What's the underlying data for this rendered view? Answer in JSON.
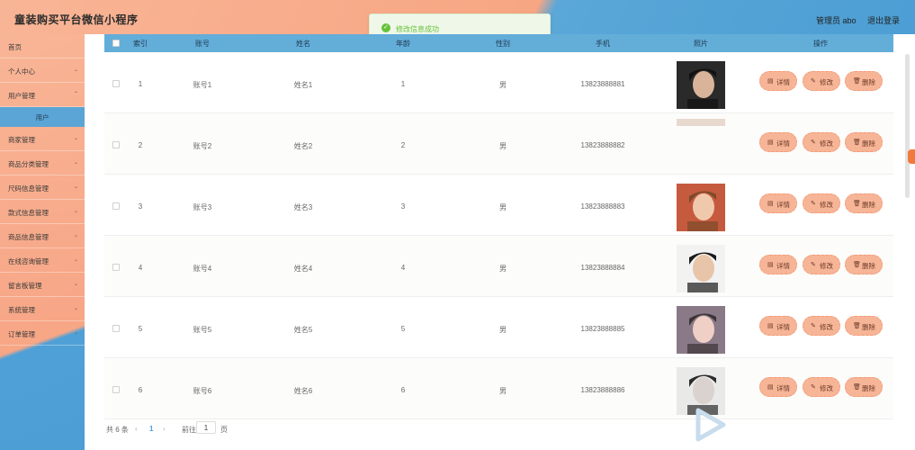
{
  "header": {
    "title": "童装购买平台微信小程序",
    "admin_label": "管理员 abo",
    "logout_label": "退出登录"
  },
  "toast": {
    "message": "修改信息成功",
    "icon": "check-circle-icon"
  },
  "sidebar": {
    "items": [
      {
        "label": "首页",
        "chevron": false
      },
      {
        "label": "个人中心",
        "chevron": true
      },
      {
        "label": "用户管理",
        "chevron": true
      },
      {
        "label": "商家管理",
        "chevron": true
      },
      {
        "label": "商品分类管理",
        "chevron": true
      },
      {
        "label": "尺码信息管理",
        "chevron": true
      },
      {
        "label": "款式信息管理",
        "chevron": true
      },
      {
        "label": "商品信息管理",
        "chevron": true
      },
      {
        "label": "在线咨询管理",
        "chevron": true
      },
      {
        "label": "留言板管理",
        "chevron": true
      },
      {
        "label": "系统管理",
        "chevron": true
      },
      {
        "label": "订单管理",
        "chevron": true
      }
    ],
    "active_sub": "用户"
  },
  "table": {
    "headers": [
      "索引",
      "账号",
      "姓名",
      "年龄",
      "性别",
      "手机",
      "照片",
      "操作"
    ],
    "rows": [
      {
        "index": "1",
        "account": "账号1",
        "name": "姓名1",
        "age": "1",
        "gender": "男",
        "phone": "13823888881"
      },
      {
        "index": "2",
        "account": "账号2",
        "name": "姓名2",
        "age": "2",
        "gender": "男",
        "phone": "13823888882"
      },
      {
        "index": "3",
        "account": "账号3",
        "name": "姓名3",
        "age": "3",
        "gender": "男",
        "phone": "13823888883"
      },
      {
        "index": "4",
        "account": "账号4",
        "name": "姓名4",
        "age": "4",
        "gender": "男",
        "phone": "13823888884"
      },
      {
        "index": "5",
        "account": "账号5",
        "name": "姓名5",
        "age": "5",
        "gender": "男",
        "phone": "13823888885"
      },
      {
        "index": "6",
        "account": "账号6",
        "name": "姓名6",
        "age": "6",
        "gender": "男",
        "phone": "13823888886"
      }
    ],
    "actions": {
      "detail_label": "详情",
      "detail_icon": "document-icon",
      "edit_label": "修改",
      "edit_icon": "pencil-icon",
      "delete_label": "删除",
      "delete_icon": "trash-icon"
    }
  },
  "pagination": {
    "total_text": "共 6 条",
    "current_page": "1",
    "goto_label": "前往",
    "goto_value": "1",
    "page_suffix": "页"
  },
  "colors": {
    "accent_orange": "#f7a683",
    "accent_blue": "#4c9ed4",
    "success_green": "#67c23a"
  }
}
